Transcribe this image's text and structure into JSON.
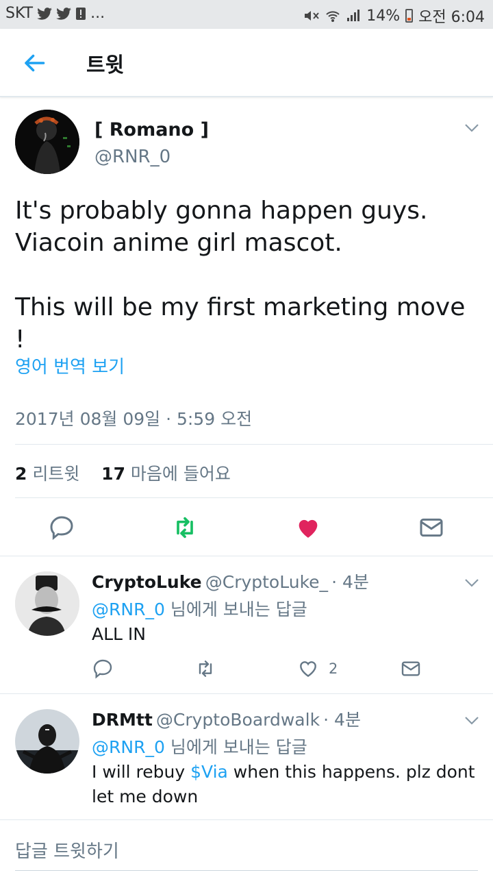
{
  "status_bar": {
    "carrier": "SKT",
    "dots": "...",
    "battery": "14%",
    "time": "오전 6:04"
  },
  "header": {
    "title": "트윗"
  },
  "tweet": {
    "name": "[ Romano ]",
    "handle": "@RNR_0",
    "text": "It's probably gonna happen guys.\nViacoin anime girl mascot.\n\nThis will be my first marketing move !",
    "translate_label": "영어 번역 보기",
    "timestamp": "2017년 08월 09일 · 5:59 오전",
    "retweets_count": "2",
    "retweets_label": "리트윗",
    "likes_count": "17",
    "likes_label": "마음에 들어요",
    "liked": true
  },
  "replies": [
    {
      "name": "CryptoLuke",
      "handle": "@CryptoLuke_",
      "time": "· 4분",
      "reply_to_mention": "@RNR_0",
      "reply_to_suffix": "님에게 보내는 답글",
      "text": "ALL IN",
      "like_count": "2"
    },
    {
      "name": "DRMtt",
      "handle": "@CryptoBoardwalk",
      "time": "· 4분",
      "reply_to_mention": "@RNR_0",
      "reply_to_suffix": "님에게 보내는 답글",
      "text_pre": "I will rebuy ",
      "cashtag": "$Via",
      "text_post": " when this happens. plz dont let me down"
    }
  ],
  "compose": {
    "placeholder": "답글 트윗하기"
  },
  "colors": {
    "accent": "#1da1f2",
    "retweet": "#17bf63",
    "like": "#e0245e",
    "muted": "#657786"
  }
}
